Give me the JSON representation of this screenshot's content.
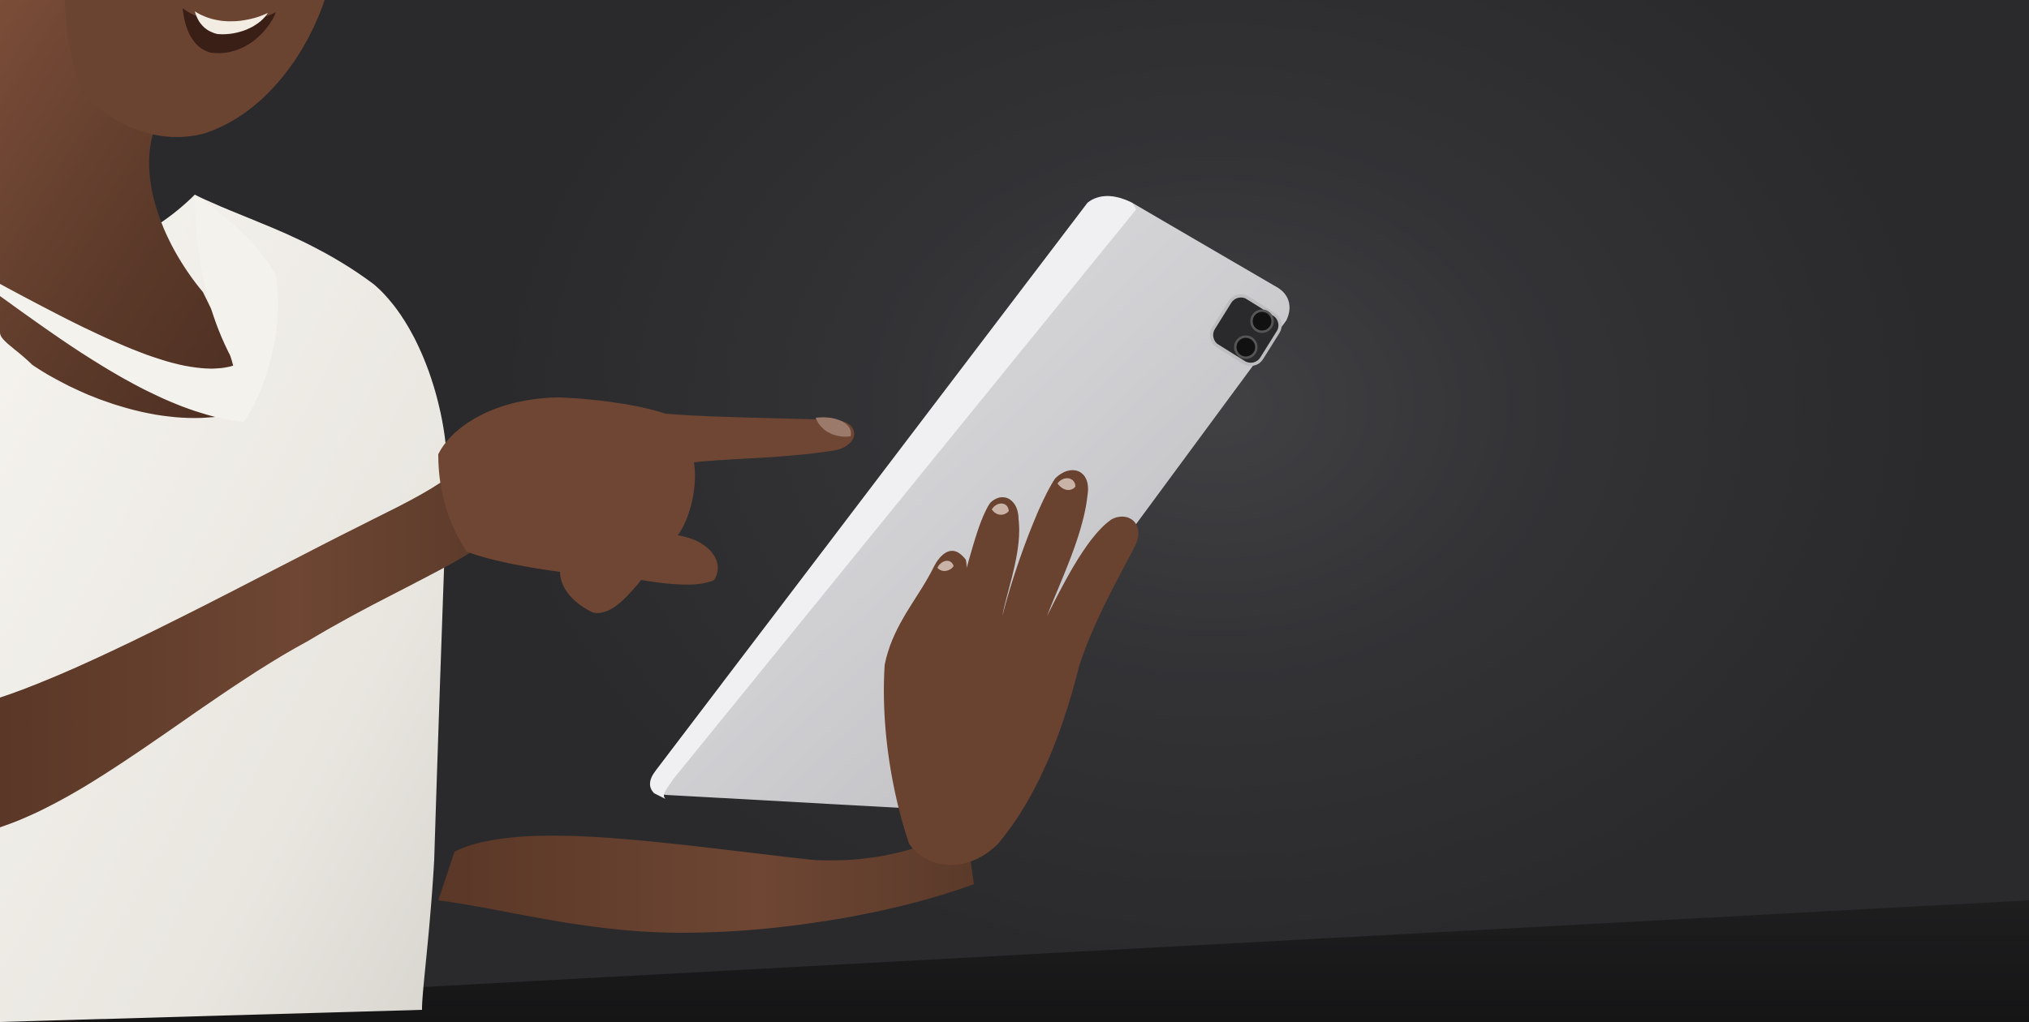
{
  "scene": {
    "description_colors": {
      "backdrop": "#2e2e30",
      "floor_band": "#1b1b1c",
      "shirt": "#f1efea",
      "skin": "#6a4331",
      "tablet_body": "#cfcfd1",
      "tablet_edge": "#e9e9eb",
      "camera": "#1d1d1f"
    },
    "icons": [
      "person-photo",
      "tablet-device"
    ]
  }
}
